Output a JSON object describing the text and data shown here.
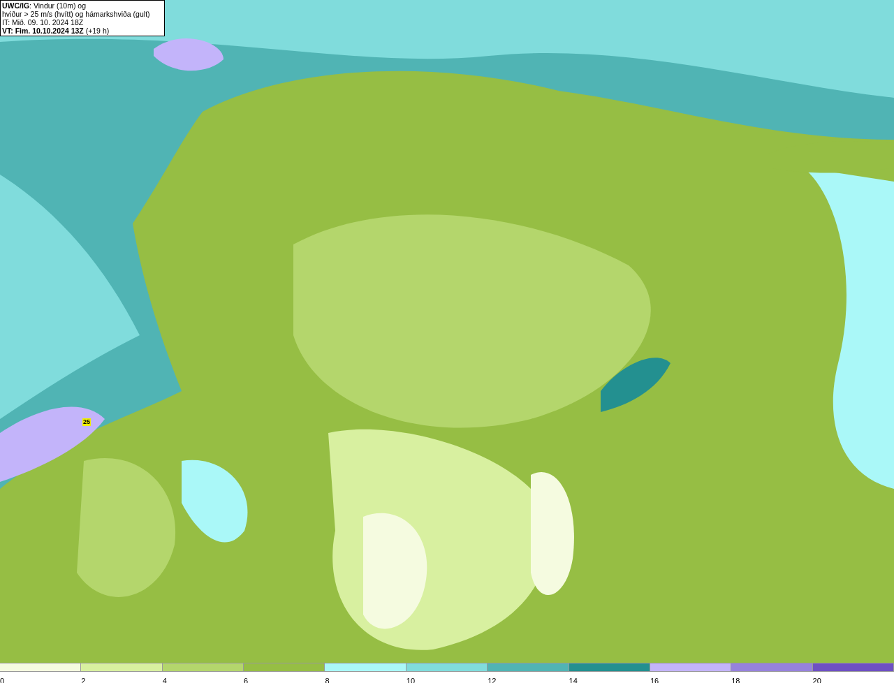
{
  "title_box": {
    "lines": [
      "**UWC/IG**: Vindur (10m) og",
      "hviður > 25 m/s (hvítt) og hámarkshviða (gult)",
      "IT: Mið. 09. 10. 2024 18Z",
      "**VT: Fim. 10.10.2024 13Z** (+19 h)"
    ]
  },
  "map": {
    "max_gust_marker": "25"
  },
  "legend": [
    {
      "label": "0",
      "color": "#f5fbe0"
    },
    {
      "label": "2",
      "color": "#d8f0a0"
    },
    {
      "label": "4",
      "color": "#b4d66c"
    },
    {
      "label": "6",
      "color": "#96be44"
    },
    {
      "label": "8",
      "color": "#aaf8f8"
    },
    {
      "label": "10",
      "color": "#80dcdc"
    },
    {
      "label": "12",
      "color": "#50b4b4"
    },
    {
      "label": "14",
      "color": "#239090"
    },
    {
      "label": "16",
      "color": "#c3b4fa"
    },
    {
      "label": "18",
      "color": "#9682dc"
    },
    {
      "label": "20",
      "color": "#6e50c3"
    }
  ]
}
